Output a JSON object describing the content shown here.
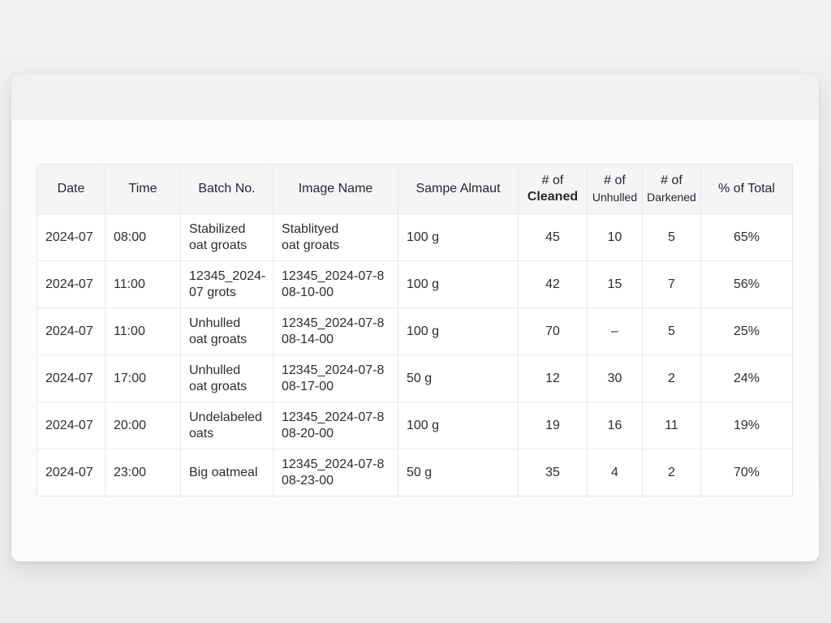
{
  "table": {
    "headers": [
      {
        "line1": "Date",
        "line2": ""
      },
      {
        "line1": "Time",
        "line2": ""
      },
      {
        "line1": "Batch No.",
        "line2": ""
      },
      {
        "line1": "Image Name",
        "line2": ""
      },
      {
        "line1": "Sampe Almaut",
        "line2": ""
      },
      {
        "line1": "# of",
        "line2": "Cleaned"
      },
      {
        "line1": "# of",
        "line2": "Unhulled"
      },
      {
        "line1": "# of",
        "line2": "Darkened"
      },
      {
        "line1": "% of Total",
        "line2": ""
      }
    ],
    "rows": [
      {
        "date": "2024-07",
        "time": "08:00",
        "batch": [
          "Stabilized",
          "oat groats"
        ],
        "image": [
          "Stablityed",
          "oat groats"
        ],
        "sample": "100 g",
        "cleaned": "45",
        "unhulled": "10",
        "darkened": "5",
        "pct": "65%"
      },
      {
        "date": "2024-07",
        "time": "11:00",
        "batch": [
          "12345_2024-",
          "07 grots"
        ],
        "image": [
          "12345_2024-07-8",
          "08-10-00"
        ],
        "sample": "100 g",
        "cleaned": "42",
        "unhulled": "15",
        "darkened": "7",
        "pct": "56%"
      },
      {
        "date": "2024-07",
        "time": "11:00",
        "batch": [
          "Unhulled",
          "oat groats"
        ],
        "image": [
          "12345_2024-07-8",
          "08-14-00"
        ],
        "sample": "100 g",
        "cleaned": "70",
        "unhulled": "–",
        "darkened": "5",
        "pct": "25%"
      },
      {
        "date": "2024-07",
        "time": "17:00",
        "batch": [
          "Unhulled",
          "oat groats"
        ],
        "image": [
          "12345_2024-07-8",
          "08-17-00"
        ],
        "sample": "50 g",
        "cleaned": "12",
        "unhulled": "30",
        "darkened": "2",
        "pct": "24%"
      },
      {
        "date": "2024-07",
        "time": "20:00",
        "batch": [
          "Undelabeled",
          "oats"
        ],
        "image": [
          "12345_2024-07-8",
          "08-20-00"
        ],
        "sample": "100 g",
        "cleaned": "19",
        "unhulled": "16",
        "darkened": "11",
        "pct": "19%"
      },
      {
        "date": "2024-07",
        "time": "23:00",
        "batch": [
          "Big oatmeal",
          ""
        ],
        "image": [
          "12345_2024-07-8",
          "08-23-00"
        ],
        "sample": "50 g",
        "cleaned": "35",
        "unhulled": "4",
        "darkened": "2",
        "pct": "70%"
      }
    ]
  }
}
